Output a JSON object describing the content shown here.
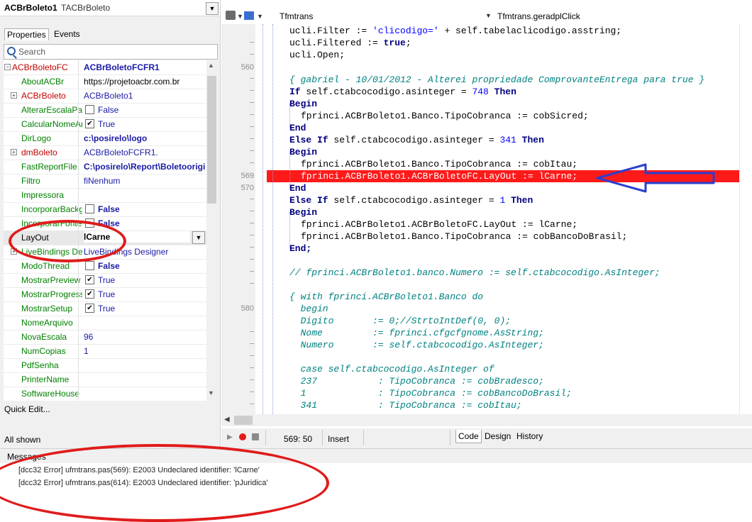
{
  "inspector": {
    "component_name": "ACBrBoleto1",
    "component_type": "TACBrBoleto",
    "tabs": {
      "properties": "Properties",
      "events": "Events"
    },
    "search_placeholder": "Search",
    "rows": [
      {
        "name": "ACBrBoletoFC",
        "value": "ACBrBoletoFCFR1"
      },
      {
        "name": "AboutACBr",
        "value": "https://projetoacbr.com.br"
      },
      {
        "name": "ACBrBoleto",
        "value": "ACBrBoleto1"
      },
      {
        "name": "AlterarEscalaPadrao",
        "value": "False"
      },
      {
        "name": "CalcularNomeArquivo",
        "value": "True"
      },
      {
        "name": "DirLogo",
        "value": "c:\\posirelo\\logo"
      },
      {
        "name": "dmBoleto",
        "value": "ACBrBoletoFCFR1."
      },
      {
        "name": "FastReportFile",
        "value": "C:\\posirelo\\Report\\Boletoorigi"
      },
      {
        "name": "Filtro",
        "value": "fiNenhum"
      },
      {
        "name": "Impressora",
        "value": ""
      },
      {
        "name": "IncorporarBackground",
        "value": "False"
      },
      {
        "name": "IncorporarFontes",
        "value": "False"
      },
      {
        "name": "LayOut",
        "value": "lCarne"
      },
      {
        "name": "LiveBindings Designer",
        "value": "LiveBindings Designer"
      },
      {
        "name": "ModoThread",
        "value": "False"
      },
      {
        "name": "MostrarPreview",
        "value": "True"
      },
      {
        "name": "MostrarProgresso",
        "value": "True"
      },
      {
        "name": "MostrarSetup",
        "value": "True"
      },
      {
        "name": "NomeArquivo",
        "value": ""
      },
      {
        "name": "NovaEscala",
        "value": "96"
      },
      {
        "name": "NumCopias",
        "value": "1"
      },
      {
        "name": "PdfSenha",
        "value": ""
      },
      {
        "name": "PrinterName",
        "value": ""
      },
      {
        "name": "SoftwareHouse",
        "value": ""
      }
    ],
    "quick_edit": "Quick Edit...",
    "all_shown": "All shown"
  },
  "editor": {
    "unit": "Tfmtrans",
    "method": "Tfmtrans.geradplClick",
    "gutter": {
      "l560": "560",
      "l569": "569",
      "l570": "570",
      "l580": "580"
    },
    "lines": {
      "l1": "ucli.Filter := ",
      "l1s": "'clicodigo='",
      "l1e": " + self.tabelaclicodigo.asstring;",
      "l2a": "ucli.Filtered := ",
      "l2k": "true",
      "l2e": ";",
      "l3": "ucli.Open;",
      "l4": "{ gabriel - 10/01/2012 - Alterei propriedade ComprovanteEntrega para true }",
      "l5k": "If",
      "l5a": " self.ctabcocodigo.asinteger = ",
      "l5n": "748",
      "l5t": "Then",
      "l6": "Begin",
      "l7": "fprinci.ACBrBoleto1.Banco.TipoCobranca := cobSicred;",
      "l8": "End",
      "l9k": "Else If",
      "l9a": " self.ctabcocodigo.asinteger = ",
      "l9n": "341",
      "l9t": "Then",
      "l10": "Begin",
      "l11": "fprinci.ACBrBoleto1.Banco.TipoCobranca := cobItau;",
      "l12": "fprinci.ACBrBoleto1.ACBrBoletoFC.LayOut := lCarne;",
      "l13": "End",
      "l14k": "Else If",
      "l14a": " self.ctabcocodigo.asinteger = ",
      "l14n": "1",
      "l14t": "Then",
      "l15": "Begin",
      "l16": "fprinci.ACBrBoleto1.ACBrBoletoFC.LayOut := lCarne;",
      "l17": "fprinci.ACBrBoleto1.Banco.TipoCobranca := cobBancoDoBrasil;",
      "l18": "End;",
      "l19": "// fprinci.ACBrBoleto1.banco.Numero := self.ctabcocodigo.AsInteger;",
      "l20": "{ with fprinci.ACBrBoleto1.Banco do",
      "l21": "  begin",
      "l22": "  Digito       := 0;//StrtoIntDef(0, 0);",
      "l23": "  Nome         := fprinci.cfgcfgnome.AsString;",
      "l24": "  Numero       := self.ctabcocodigo.AsInteger;",
      "l25": "  case self.ctabcocodigo.AsInteger of",
      "l26": "  237           : TipoCobranca := cobBradesco;",
      "l27": "  1             : TipoCobranca := cobBancoDoBrasil;",
      "l28": "  341           : TipoCobranca := cobItau;"
    }
  },
  "status": {
    "cursor": "569:  50",
    "mode": "Insert"
  },
  "bottom_tabs": {
    "code": "Code",
    "design": "Design",
    "history": "History"
  },
  "messages": {
    "title": "Messages",
    "items": [
      "[dcc32 Error] ufmtrans.pas(569): E2003 Undeclared identifier: 'lCarne'",
      "[dcc32 Error] ufmtrans.pas(614): E2003 Undeclared identifier: 'pJuridica'"
    ]
  },
  "colors": {
    "breakpoint": "#ff1a1a",
    "annotation": "#e01b1b",
    "arrow": "#2a3fcf"
  }
}
